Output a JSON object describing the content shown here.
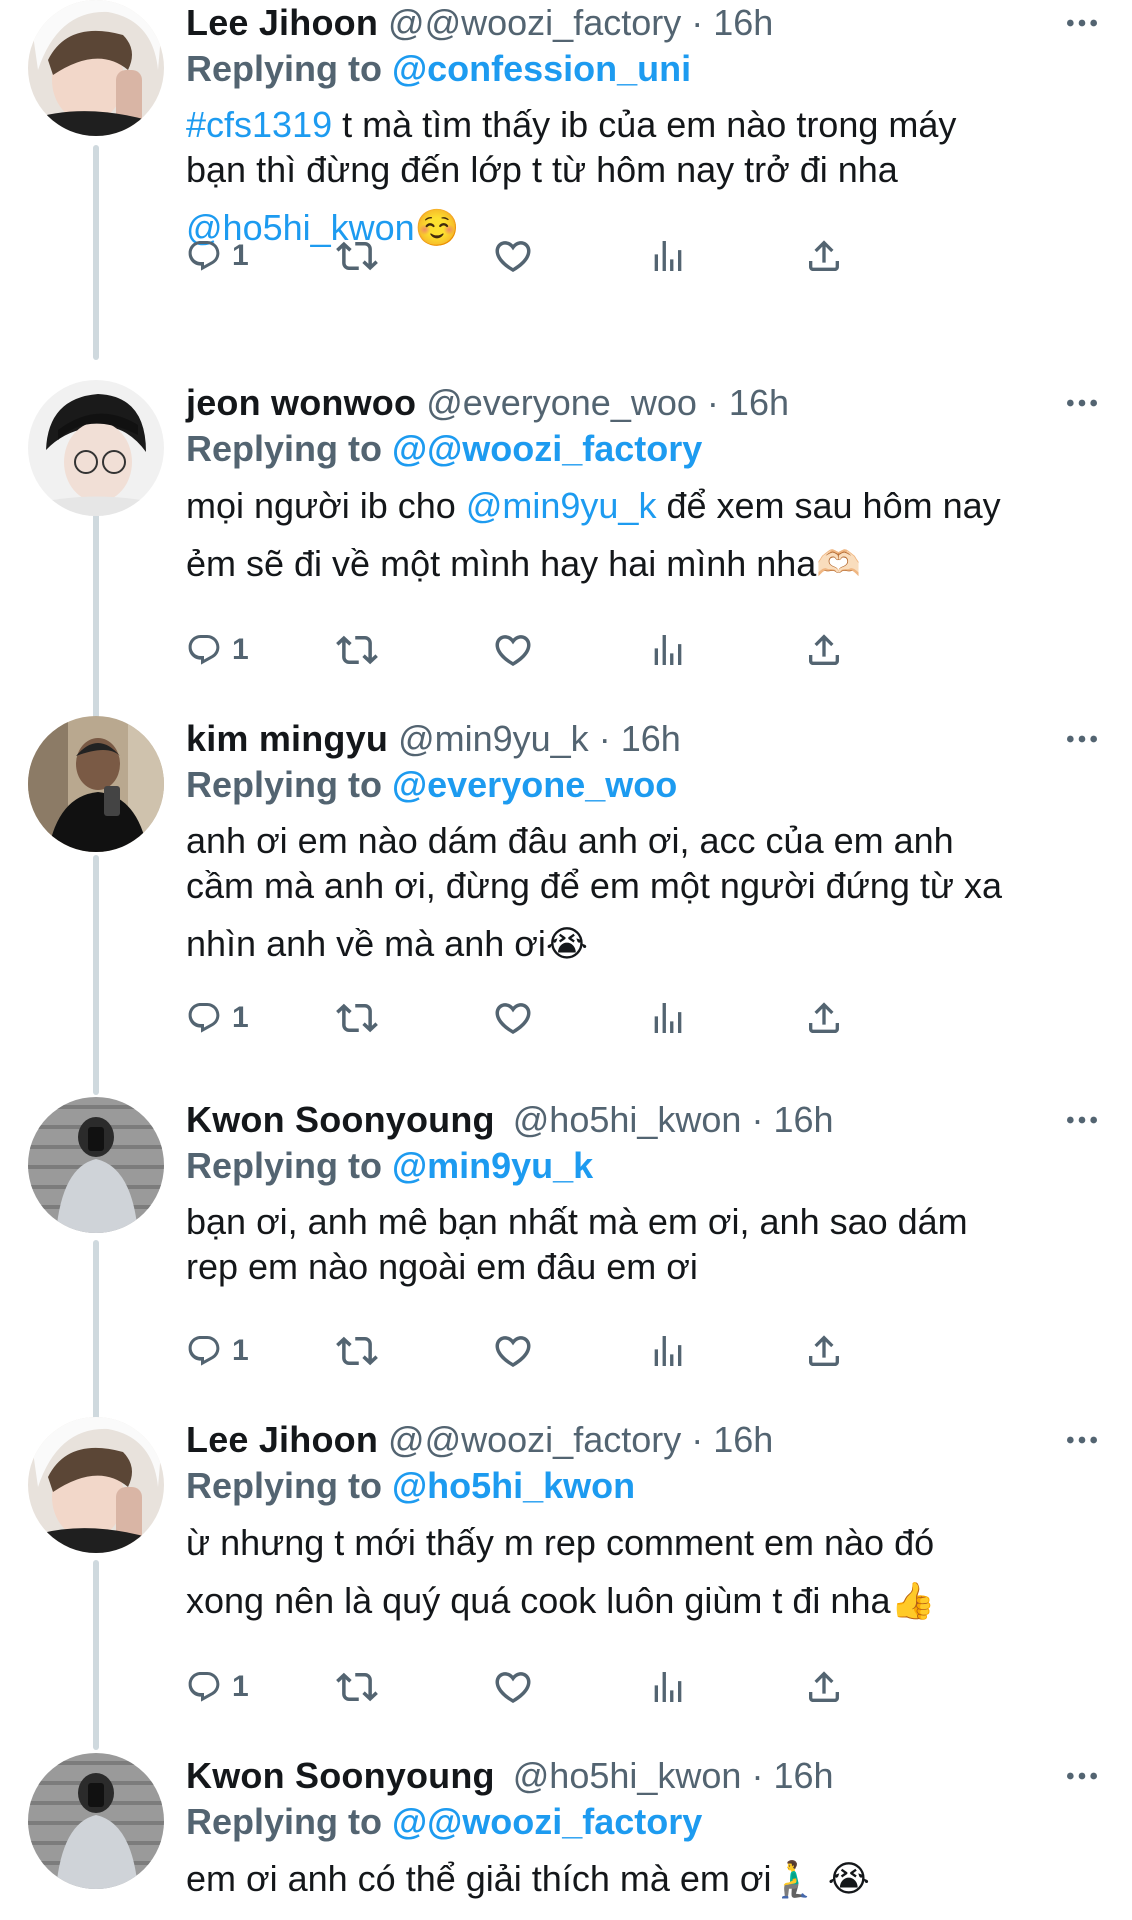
{
  "tweets": [
    {
      "name": "Lee Jihoon",
      "handle": "@@woozi_factory",
      "dot": "·",
      "time": "16h",
      "reply_prefix": "Replying to",
      "reply_to": "@confession_uni",
      "hashtag": "#cfs1319",
      "text_line1_rest": " t mà tìm thấy ib của em nào trong máy",
      "text_line2": "bạn thì đừng đến lớp t từ hôm nay trở đi nha",
      "text_line3_mention": "@ho5hi_kwon",
      "text_line3_emoji": "☺️",
      "reply_count": "1",
      "avatar": "avatar-lee-jihoon"
    },
    {
      "name": "jeon wonwoo",
      "handle": "@everyone_woo",
      "dot": "·",
      "time": "16h",
      "reply_prefix": "Replying to",
      "reply_to": "@@woozi_factory",
      "text_line1_pre": "mọi người ib cho ",
      "text_line1_mention": "@min9yu_k",
      "text_line1_post": " để xem sau hôm nay",
      "text_line2": "ẻm sẽ đi về một mình hay hai mình nha",
      "text_line2_emoji": "🫶🏻",
      "reply_count": "1",
      "avatar": "avatar-jeon-wonwoo"
    },
    {
      "name": "kim mingyu",
      "handle": "@min9yu_k",
      "dot": "·",
      "time": "16h",
      "reply_prefix": "Replying to",
      "reply_to": "@everyone_woo",
      "text_line1": "anh ơi em nào dám đâu anh ơi, acc của em anh",
      "text_line2": "cầm mà anh ơi, đừng để em một người đứng từ xa",
      "text_line3": "nhìn anh về mà anh ơi",
      "text_line3_emoji": "😭",
      "reply_count": "1",
      "avatar": "avatar-kim-mingyu"
    },
    {
      "name": "Kwon Soonyoung",
      "handle": "@ho5hi_kwon",
      "dot": "·",
      "time": "16h",
      "reply_prefix": "Replying to",
      "reply_to": "@min9yu_k",
      "text_line1": "bạn ơi, anh mê bạn nhất mà em ơi, anh sao dám",
      "text_line2": "rep em nào ngoài em đâu em ơi",
      "reply_count": "1",
      "avatar": "avatar-kwon-soonyoung"
    },
    {
      "name": "Lee Jihoon",
      "handle": "@@woozi_factory",
      "dot": "·",
      "time": "16h",
      "reply_prefix": "Replying to",
      "reply_to": "@ho5hi_kwon",
      "text_line1": "ừ nhưng t mới thấy m rep comment em nào đó",
      "text_line2": "xong nên là quý quá cook luôn giùm t đi nha",
      "text_line2_emoji": "👍",
      "reply_count": "1",
      "avatar": "avatar-lee-jihoon"
    },
    {
      "name": "Kwon Soonyoung",
      "handle": "@ho5hi_kwon",
      "dot": "·",
      "time": "16h",
      "reply_prefix": "Replying to",
      "reply_to": "@@woozi_factory",
      "text_line1": "em ơi anh có thể giải thích mà em ơi",
      "text_line1_emoji": "🧎‍♂️ 😭",
      "avatar": "avatar-kwon-soonyoung"
    }
  ],
  "icons": {
    "reply": "reply-icon",
    "retweet": "retweet-icon",
    "like": "heart-icon",
    "views": "views-chart-icon",
    "share": "share-icon",
    "more": "more-options-icon"
  },
  "colors": {
    "link": "#1d9bf0",
    "secondary_text": "#536471",
    "thread_line": "#cfd9de"
  }
}
